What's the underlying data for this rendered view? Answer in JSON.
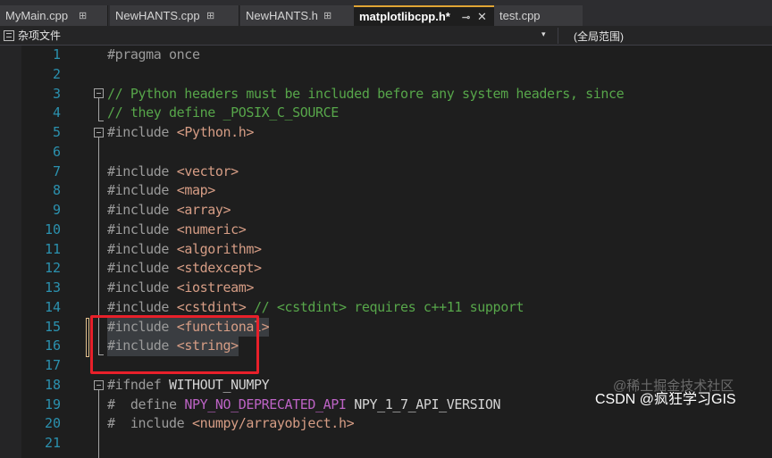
{
  "tabs": [
    {
      "label": "MyMain.cpp",
      "pin": "⊞"
    },
    {
      "label": "NewHANTS.cpp",
      "pin": "⊞"
    },
    {
      "label": "NewHANTS.h",
      "pin": "⊞"
    },
    {
      "label": "matplotlibcpp.h*",
      "pin": "⊸",
      "close": "✕",
      "active": true
    },
    {
      "label": "test.cpp"
    }
  ],
  "navbar": {
    "project_scope": "杂项文件",
    "caret": "▾",
    "global_scope": "(全局范围)"
  },
  "lines": [
    {
      "num": "1",
      "seg": [
        [
          "kw",
          "#pragma once"
        ]
      ]
    },
    {
      "num": "2",
      "seg": []
    },
    {
      "num": "3",
      "seg": [
        [
          "cm",
          "// Python headers must be included before any system headers, since"
        ]
      ]
    },
    {
      "num": "4",
      "seg": [
        [
          "cm",
          "// they define _POSIX_C_SOURCE"
        ]
      ]
    },
    {
      "num": "5",
      "seg": [
        [
          "kw",
          "#include "
        ],
        [
          "inc",
          "<Python.h>"
        ]
      ]
    },
    {
      "num": "6",
      "seg": []
    },
    {
      "num": "7",
      "seg": [
        [
          "kw",
          "#include "
        ],
        [
          "inc",
          "<vector>"
        ]
      ]
    },
    {
      "num": "8",
      "seg": [
        [
          "kw",
          "#include "
        ],
        [
          "inc",
          "<map>"
        ]
      ]
    },
    {
      "num": "9",
      "seg": [
        [
          "kw",
          "#include "
        ],
        [
          "inc",
          "<array>"
        ]
      ]
    },
    {
      "num": "10",
      "seg": [
        [
          "kw",
          "#include "
        ],
        [
          "inc",
          "<numeric>"
        ]
      ]
    },
    {
      "num": "11",
      "seg": [
        [
          "kw",
          "#include "
        ],
        [
          "inc",
          "<algorithm>"
        ]
      ]
    },
    {
      "num": "12",
      "seg": [
        [
          "kw",
          "#include "
        ],
        [
          "inc",
          "<stdexcept>"
        ]
      ]
    },
    {
      "num": "13",
      "seg": [
        [
          "kw",
          "#include "
        ],
        [
          "inc",
          "<iostream>"
        ]
      ]
    },
    {
      "num": "14",
      "seg": [
        [
          "kw",
          "#include "
        ],
        [
          "inc",
          "<cstdint>"
        ],
        [
          "cm",
          " // <cstdint> requires c++11 support"
        ]
      ]
    },
    {
      "num": "15",
      "seg": [
        [
          "kw",
          "#include "
        ],
        [
          "inc",
          "<functional>"
        ]
      ],
      "hl": true
    },
    {
      "num": "16",
      "seg": [
        [
          "kw",
          "#include "
        ],
        [
          "inc",
          "<string>"
        ]
      ],
      "hl": true
    },
    {
      "num": "17",
      "seg": []
    },
    {
      "num": "18",
      "seg": [
        [
          "kw",
          "#ifndef "
        ],
        [
          "plain",
          "WITHOUT_NUMPY"
        ]
      ]
    },
    {
      "num": "19",
      "seg": [
        [
          "kw",
          "#  define "
        ],
        [
          "mac",
          "NPY_NO_DEPRECATED_API"
        ],
        [
          "plain",
          " NPY_1_7_API_VERSION"
        ]
      ]
    },
    {
      "num": "20",
      "seg": [
        [
          "kw",
          "#  include "
        ],
        [
          "inc",
          "<numpy/arrayobject.h>"
        ]
      ]
    },
    {
      "num": "21",
      "seg": []
    }
  ],
  "watermark": {
    "juejin": "@稀土掘金技术社区",
    "csdn": "CSDN @疯狂学习GIS"
  },
  "colors": {
    "line_number": "#2b91af",
    "comment": "#57a64a",
    "include_path": "#d69d85",
    "preprocessor": "#9b9b9b",
    "macro": "#bd63c5",
    "active_tab_accent": "#e0a434",
    "annotation_box": "#e8202a"
  }
}
